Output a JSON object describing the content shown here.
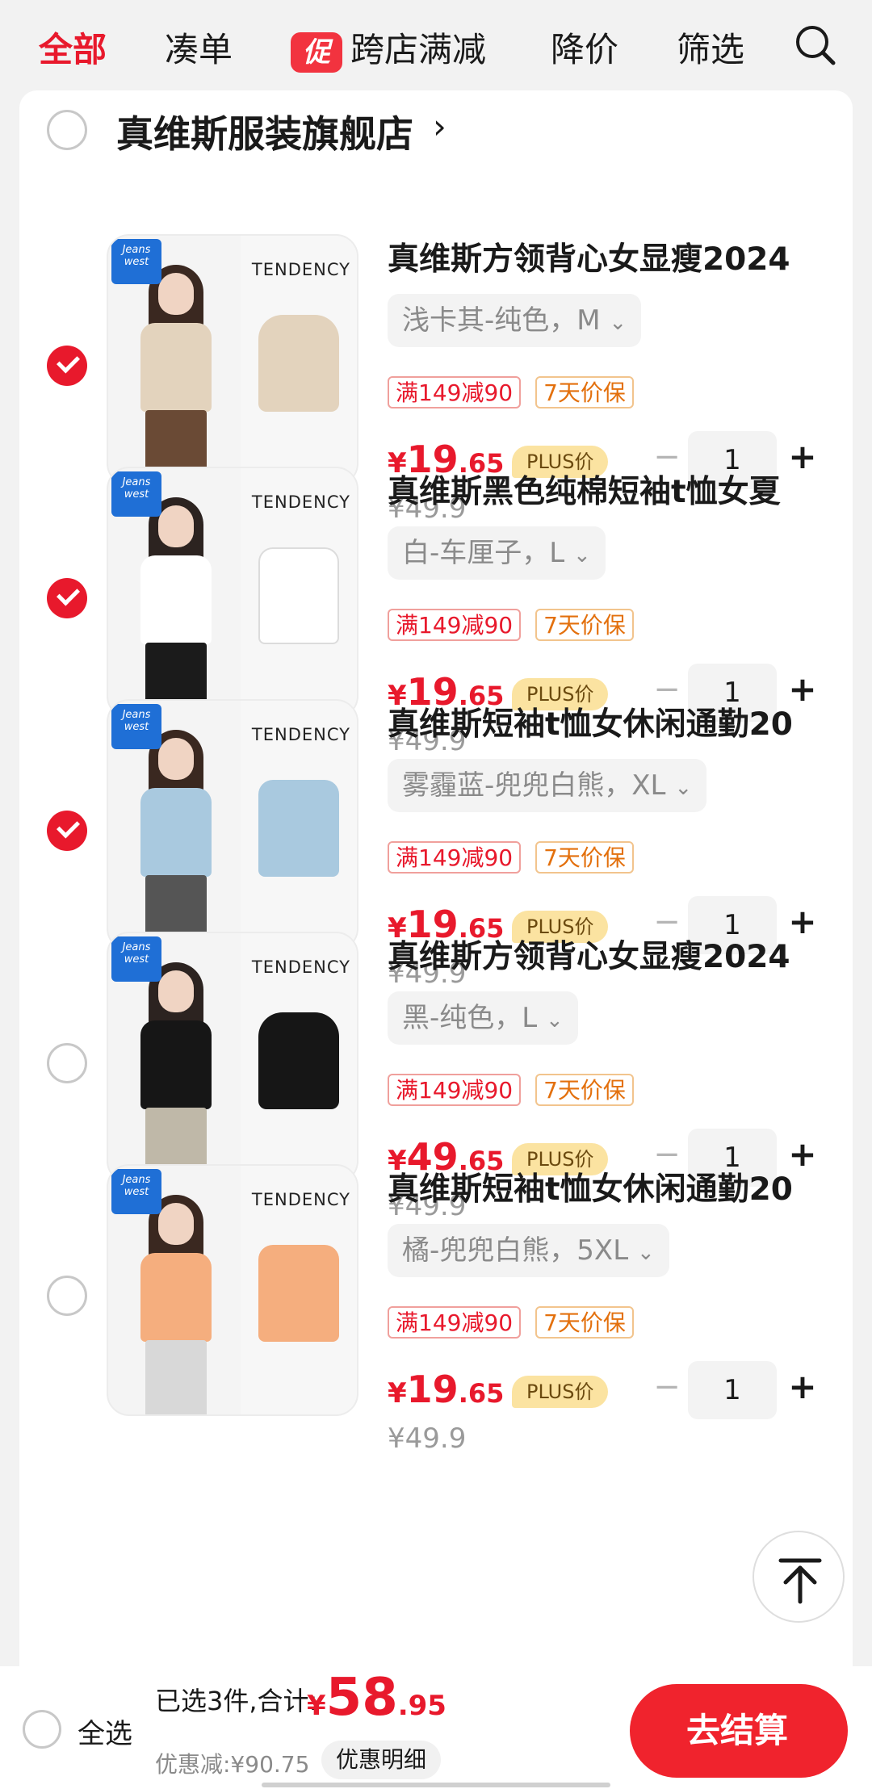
{
  "topbar": {
    "tabs": [
      "全部",
      "凑单",
      "跨店满减",
      "降价",
      "筛选"
    ],
    "promo_badge": "促"
  },
  "shop": {
    "name": "真维斯服装旗舰店",
    "chevron": "›"
  },
  "thumbnail": {
    "tendency": "TENDENCY",
    "brand_logo": "Jeans west"
  },
  "items": [
    {
      "title": "真维斯方领背心女显瘦2024",
      "variant": "浅卡其-纯色，M",
      "tags": [
        "满149减90",
        "7天价保"
      ],
      "price_currency": "¥",
      "price_int": "19",
      "price_dec": ".65",
      "plus_label": "PLUS价",
      "old_price": "¥49.9",
      "qty": "1",
      "checked": true,
      "colors": {
        "garment": "#e3d3bd",
        "legs": "#6a4a35",
        "hair": "#3a2820"
      }
    },
    {
      "title": "真维斯黑色纯棉短袖t恤女夏",
      "variant": "白-车厘子，L",
      "tags": [
        "满149减90",
        "7天价保"
      ],
      "price_currency": "¥",
      "price_int": "19",
      "price_dec": ".65",
      "plus_label": "PLUS价",
      "old_price": "¥49.9",
      "qty": "1",
      "checked": true,
      "colors": {
        "garment": "#ffffff",
        "legs": "#1b1b1b",
        "hair": "#2c2320"
      }
    },
    {
      "title": "真维斯短袖t恤女休闲通勤20",
      "variant": "雾霾蓝-兜兜白熊，XL",
      "tags": [
        "满149减90",
        "7天价保"
      ],
      "price_currency": "¥",
      "price_int": "19",
      "price_dec": ".65",
      "plus_label": "PLUS价",
      "old_price": "¥49.9",
      "qty": "1",
      "checked": true,
      "colors": {
        "garment": "#a9c9df",
        "legs": "#555555",
        "hair": "#3a2820"
      }
    },
    {
      "title": "真维斯方领背心女显瘦2024",
      "variant": "黑-纯色，L",
      "tags": [
        "满149减90",
        "7天价保"
      ],
      "price_currency": "¥",
      "price_int": "49",
      "price_dec": ".65",
      "plus_label": "PLUS价",
      "old_price": "¥49.9",
      "qty": "1",
      "checked": false,
      "colors": {
        "garment": "#161616",
        "legs": "#bfb8a8",
        "hair": "#2c2320"
      }
    },
    {
      "title": "真维斯短袖t恤女休闲通勤20",
      "variant": "橘-兜兜白熊，5XL",
      "tags": [
        "满149减90",
        "7天价保"
      ],
      "price_currency": "¥",
      "price_int": "19",
      "price_dec": ".65",
      "plus_label": "PLUS价",
      "old_price": "¥49.9",
      "qty": "1",
      "checked": false,
      "colors": {
        "garment": "#f5ae7e",
        "legs": "#d8d8d8",
        "hair": "#3a2820"
      }
    }
  ],
  "bottombar": {
    "select_all": "全选",
    "summary": "已选3件,合计:",
    "total_currency": "¥",
    "total_int": "58",
    "total_dec": ".95",
    "discount": "优惠减:¥90.75",
    "detail_button": "优惠明细",
    "checkout": "去结算"
  },
  "icons": {
    "search": "search-icon",
    "scroll_top": "arrow-up-icon",
    "check": "check-icon"
  },
  "colors": {
    "accent": "#e8192c",
    "plus_badge": "#fbe3a1",
    "tag_orange": "#e3700d"
  }
}
